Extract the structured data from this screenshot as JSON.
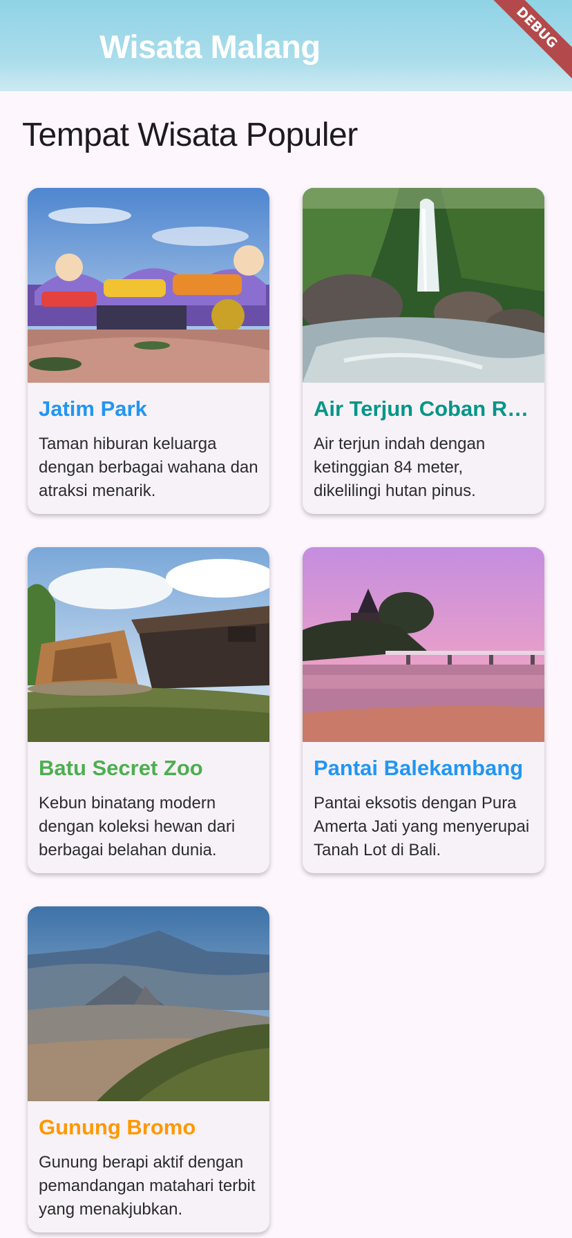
{
  "app_bar": {
    "title": "Wisata Malang",
    "debug_banner": "DEBUG"
  },
  "section_title": "Tempat Wisata Populer",
  "cards": [
    {
      "name": "Jatim Park",
      "name_color": "#2196f3",
      "description": "Taman hiburan keluarga dengan berbagai wahana dan atraksi menarik.",
      "image": "theme-park-photo"
    },
    {
      "name": "Air Terjun Coban Rondo",
      "name_color": "#009688",
      "description": "Air terjun indah dengan ketinggian 84 meter, dikelilingi hutan pinus.",
      "image": "waterfall-photo"
    },
    {
      "name": "Batu Secret Zoo",
      "name_color": "#4caf50",
      "description": "Kebun binatang modern dengan koleksi hewan dari berbagai belahan dunia.",
      "image": "zoo-ark-photo"
    },
    {
      "name": "Pantai Balekambang",
      "name_color": "#2196f3",
      "description": "Pantai eksotis dengan Pura Amerta Jati yang menyerupai Tanah Lot di Bali.",
      "image": "beach-temple-photo"
    },
    {
      "name": "Gunung Bromo",
      "name_color": "#ff9800",
      "description": "Gunung berapi aktif dengan pemandangan matahari terbit yang menakjubkan.",
      "image": "volcano-photo"
    }
  ]
}
